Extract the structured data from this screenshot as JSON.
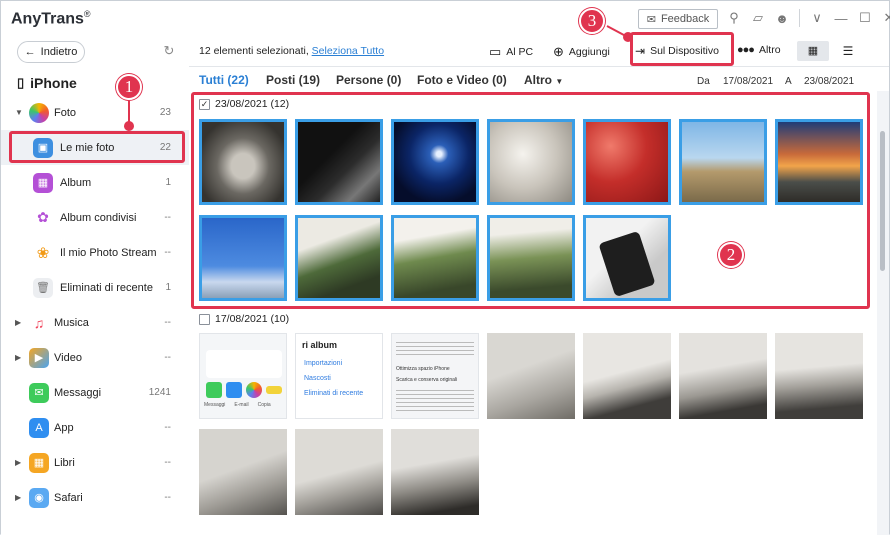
{
  "app": {
    "name": "AnyTrans",
    "reg": "®"
  },
  "titlebar": {
    "feedback_label": "Feedback"
  },
  "sidebar": {
    "back_label": "Indietro",
    "device_name": "iPhone",
    "items": [
      {
        "label": "Foto",
        "count": "23"
      },
      {
        "label": "Le mie foto",
        "count": "22"
      },
      {
        "label": "Album",
        "count": "1"
      },
      {
        "label": "Album condivisi",
        "count": "--"
      },
      {
        "label": "Il mio Photo Stream",
        "count": "--"
      },
      {
        "label": "Eliminati di recente",
        "count": "1"
      },
      {
        "label": "Musica",
        "count": "--"
      },
      {
        "label": "Video",
        "count": "--"
      },
      {
        "label": "Messaggi",
        "count": "1241"
      },
      {
        "label": "App",
        "count": "--"
      },
      {
        "label": "Libri",
        "count": "--"
      },
      {
        "label": "Safari",
        "count": "--"
      }
    ]
  },
  "toolbar": {
    "selected_text": "12 elementi selezionati,",
    "select_all": "Seleziona Tutto",
    "to_pc": "Al PC",
    "add": "Aggiungi",
    "to_device": "Sul Dispositivo",
    "more": "Altro"
  },
  "filters": {
    "tabs": [
      "Tutti (22)",
      "Posti (19)",
      "Persone (0)",
      "Foto e Video (0)",
      "Altro"
    ],
    "from_label": "Da",
    "from_date": "17/08/2021",
    "to_label": "A",
    "to_date": "23/08/2021"
  },
  "groups": [
    {
      "date": "23/08/2021 (12)",
      "checked": true
    },
    {
      "date": "17/08/2021 (10)",
      "checked": false
    }
  ],
  "screenshot_text": {
    "album_title": "ri album",
    "rows": [
      "Importazioni",
      "Nascosti",
      "Eliminati di recente"
    ],
    "apps": [
      "Messaggi",
      "E-mail",
      "Copia"
    ],
    "settings": [
      "Ottimizza spazio iPhone",
      "Scarica e conserva originali"
    ]
  },
  "callouts": [
    "1",
    "2",
    "3"
  ],
  "colors": {
    "accent": "#2a7fd4",
    "callout": "#e0344f",
    "selection": "#3a9ee6"
  }
}
